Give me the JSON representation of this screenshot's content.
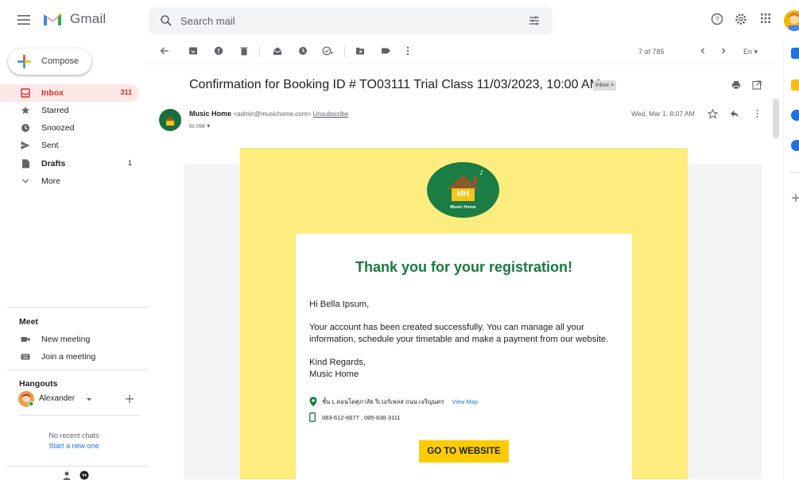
{
  "app": {
    "name": "Gmail"
  },
  "search": {
    "placeholder": "Search mail"
  },
  "compose": {
    "label": "Compose"
  },
  "nav": {
    "items": [
      {
        "label": "Inbox",
        "count": "311",
        "icon": "inbox-icon"
      },
      {
        "label": "Starred",
        "count": "",
        "icon": "star-icon"
      },
      {
        "label": "Snoozed",
        "count": "",
        "icon": "clock-icon"
      },
      {
        "label": "Sent",
        "count": "",
        "icon": "send-icon"
      },
      {
        "label": "Drafts",
        "count": "1",
        "icon": "draft-icon"
      },
      {
        "label": "More",
        "count": "",
        "icon": "chevron-down-icon"
      }
    ]
  },
  "meet": {
    "title": "Meet",
    "new_meeting": "New meeting",
    "join_meeting": "Join a meeting"
  },
  "hangouts": {
    "title": "Hangouts",
    "user": "Alexander",
    "no_chats": "No recent chats",
    "start_new": "Start a new one"
  },
  "toolbar": {
    "pager": "7 of 785",
    "lang": "En"
  },
  "email": {
    "subject": "Confirmation for Booking ID # TO03111 Trial Class 11/03/2023, 10:00 AM",
    "label_chip": "Inbox ×",
    "sender_name": "Music Home",
    "sender_email": "<admin@musichome.com>",
    "unsubscribe": "Unsubscribe",
    "to": "to me",
    "date": "Wed, Mar 1, 8:07 AM"
  },
  "body": {
    "logo_text": "MH",
    "logo_sub": "Music Home",
    "heading": "Thank you for your registration!",
    "greeting": "Hi Bella Ipsum,",
    "para1_line1": "Your account has been created successfully. You can manage all your",
    "para1_line2": "information, schedule your timetable and make a payment from our website.",
    "regards": "Kind Regards,",
    "signature": "Music Home",
    "address": "ชั้น L คอนโดศุภาลัย ริเวอร์เพลส ถนน เจริญนคร",
    "view_map": "View Map",
    "phone": "083-612-6677 , 085-836-3111",
    "cta": "GO TO WEBSITE"
  },
  "colors": {
    "brand_green": "#187a3c",
    "email_yellow": "#fdec7e",
    "cta_yellow": "#fccc03",
    "inbox_red": "#d93025"
  }
}
